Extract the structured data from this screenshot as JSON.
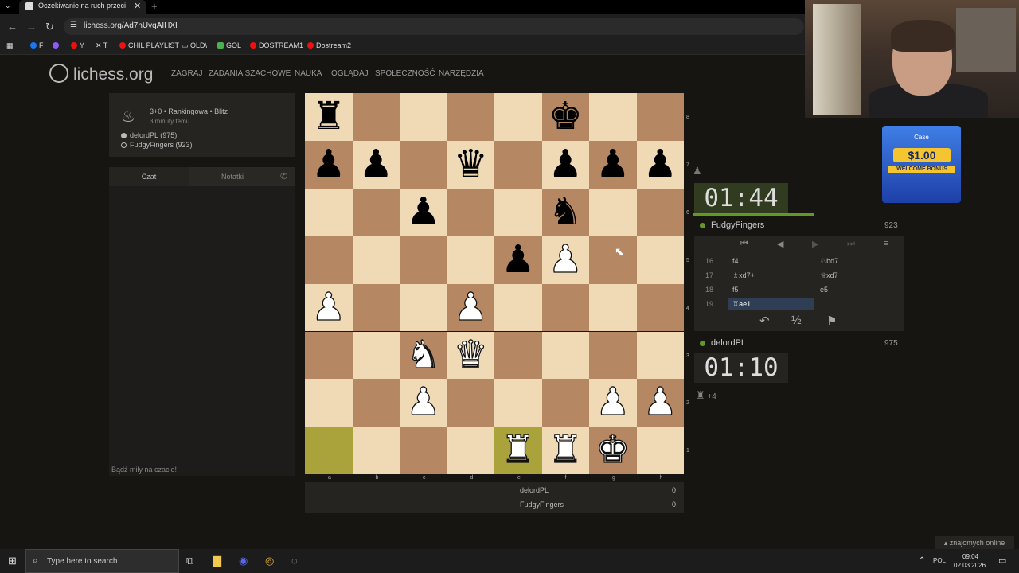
{
  "browser": {
    "tab_title": "Oczekiwanie na ruch przeciwnika",
    "url": "lichess.org/Ad7nUvqAIHXI",
    "bookmarks": [
      "F",
      "Y",
      "T",
      "CHIL PLAYLIST",
      "OLD\\",
      "GOL",
      "DOSTREAM1",
      "Dostream2"
    ]
  },
  "site": {
    "logo": "lichess.org",
    "nav": [
      "ZAGRAJ",
      "ZADANIA SZACHOWE",
      "NAUKA",
      "OGLĄDAJ",
      "SPOŁECZNOŚĆ",
      "NARZĘDZIA"
    ]
  },
  "game_info": {
    "type": "3+0 • Rankingowa • Blitz",
    "time_ago": "3 minuty temu",
    "white_player": "delordPL (975)",
    "black_player": "FudgyFingers (923)"
  },
  "chat": {
    "tab_chat": "Czat",
    "tab_notes": "Notatki",
    "footer": "Bądź miły na czacie!"
  },
  "board": {
    "files": [
      "a",
      "b",
      "c",
      "d",
      "e",
      "f",
      "g",
      "h"
    ],
    "ranks": [
      "8",
      "7",
      "6",
      "5",
      "4",
      "3",
      "2",
      "1"
    ],
    "highlights": [
      "a1",
      "e1"
    ],
    "pieces": [
      {
        "sq": "a8",
        "p": "r"
      },
      {
        "sq": "f8",
        "p": "k"
      },
      {
        "sq": "a7",
        "p": "p"
      },
      {
        "sq": "b7",
        "p": "p"
      },
      {
        "sq": "d7",
        "p": "q"
      },
      {
        "sq": "f7",
        "p": "p"
      },
      {
        "sq": "g7",
        "p": "p"
      },
      {
        "sq": "h7",
        "p": "p"
      },
      {
        "sq": "c6",
        "p": "p"
      },
      {
        "sq": "f6",
        "p": "n"
      },
      {
        "sq": "e5",
        "p": "p"
      },
      {
        "sq": "f5",
        "p": "P"
      },
      {
        "sq": "a4",
        "p": "P"
      },
      {
        "sq": "d4",
        "p": "P"
      },
      {
        "sq": "c3",
        "p": "N"
      },
      {
        "sq": "d3",
        "p": "Q"
      },
      {
        "sq": "c2",
        "p": "P"
      },
      {
        "sq": "g2",
        "p": "P"
      },
      {
        "sq": "h2",
        "p": "P"
      },
      {
        "sq": "e1",
        "p": "R"
      },
      {
        "sq": "f1",
        "p": "R"
      },
      {
        "sq": "g1",
        "p": "K"
      }
    ]
  },
  "opponent": {
    "clock": "01:44",
    "name": "FudgyFingers",
    "rating": "923"
  },
  "player": {
    "clock": "01:10",
    "name": "delordPL",
    "rating": "975",
    "material_diff": "+4"
  },
  "moves": [
    {
      "n": "16",
      "w": "f4",
      "b": "♘bd7"
    },
    {
      "n": "17",
      "w": "♗xd7+",
      "b": "♕xd7"
    },
    {
      "n": "18",
      "w": "f5",
      "b": "e5"
    },
    {
      "n": "19",
      "w": "♖ae1",
      "b": ""
    }
  ],
  "scores": [
    {
      "name": "delordPL",
      "score": "0"
    },
    {
      "name": "FudgyFingers",
      "score": "0"
    }
  ],
  "ad": {
    "brand": "Case",
    "amount": "$1.00",
    "text": "WELCOME BONUS"
  },
  "friends": "znajomych online",
  "taskbar": {
    "search_placeholder": "Type here to search",
    "lang": "POL",
    "time": "09:04",
    "date": "02.03.2026"
  }
}
